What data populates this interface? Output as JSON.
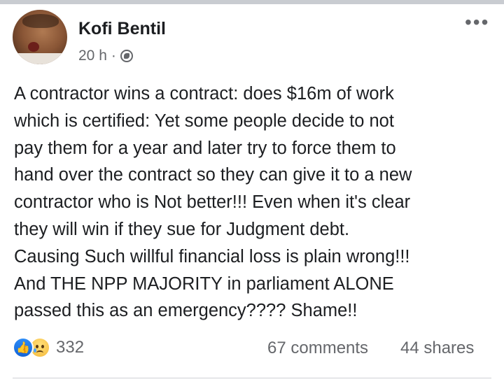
{
  "post": {
    "author": "Kofi Bentil",
    "time": "20 h",
    "separator": "·",
    "privacy_icon": "globe-icon",
    "more_label": "•••",
    "body_lines": [
      "A contractor wins a contract: does $16m of work",
      "which is certified: Yet some people decide to not",
      "pay them for a year and later try to force them to",
      "hand over the contract so they can give it to a new",
      "contractor who is Not better!!! Even when it's clear",
      "they will win if they sue for Judgment debt.",
      "Causing Such willful financial loss is plain wrong!!!",
      "And THE NPP MAJORITY in parliament ALONE",
      "passed this as an emergency???? Shame!!"
    ],
    "reaction_icons": [
      "like-icon",
      "sad-icon"
    ],
    "reaction_count": "332",
    "comments": "67 comments",
    "shares": "44 shares"
  },
  "colors": {
    "text": "#1c1e21",
    "meta": "#65676b",
    "like_blue": "#1877f2",
    "background": "#ffffff"
  }
}
